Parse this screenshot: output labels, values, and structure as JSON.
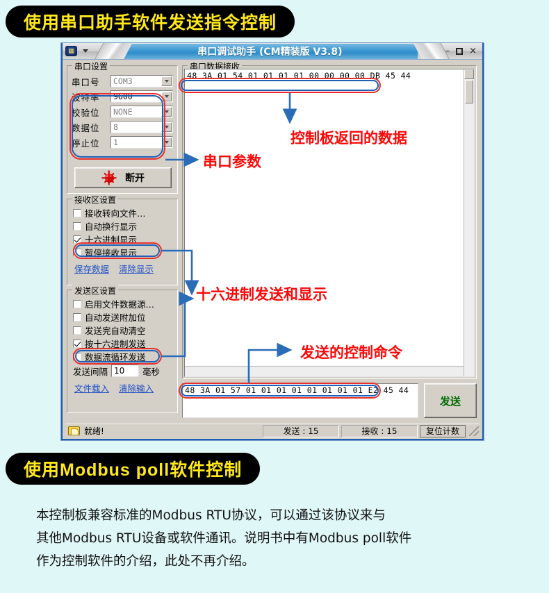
{
  "headings": {
    "top": "使用串口助手软件发送指令控制",
    "bottom": "使用Modbus poll软件控制"
  },
  "window": {
    "title": "串口调试助手 (CM精装版 V3.8)",
    "logo_icon": "app-logo-icon",
    "caret_icon": "chevron-down-icon",
    "minimize": "–",
    "maximize": "□",
    "close": "×"
  },
  "serial_group": {
    "title": "串口设置",
    "fields": [
      {
        "label": "串口号",
        "value": "COM3",
        "active": false
      },
      {
        "label": "波特率",
        "value": "9600",
        "active": true
      },
      {
        "label": "校验位",
        "value": "NONE",
        "active": false
      },
      {
        "label": "数据位",
        "value": "8",
        "active": false
      },
      {
        "label": "停止位",
        "value": "1",
        "active": false
      }
    ],
    "disconnect_label": "断开"
  },
  "recv_group": {
    "title": "接收区设置",
    "checks": [
      {
        "label": "接收转向文件…",
        "checked": false
      },
      {
        "label": "自动换行显示",
        "checked": false
      },
      {
        "label": "十六进制显示",
        "checked": true
      },
      {
        "label": "暂停接收显示",
        "checked": false
      }
    ],
    "links": [
      "保存数据",
      "清除显示"
    ]
  },
  "send_group": {
    "title": "发送区设置",
    "checks": [
      {
        "label": "启用文件数据源…",
        "checked": false
      },
      {
        "label": "自动发送附加位",
        "checked": false
      },
      {
        "label": "发送完自动清空",
        "checked": false
      },
      {
        "label": "按十六进制发送",
        "checked": true
      },
      {
        "label": "数据流循环发送",
        "checked": false
      }
    ],
    "interval_label": "发送间隔",
    "interval_value": "10",
    "interval_unit": "毫秒",
    "links": [
      "文件载入",
      "清除输入"
    ]
  },
  "rx_group": {
    "title": "串口数据接收",
    "data": "48 3A 01 54 01 01 01 01 00 00 00 00 DB 45 44"
  },
  "tx_area": {
    "data": "48 3A 01 57 01 01 01 01 01 01 01 01 E2 45 44",
    "send_button": "发送"
  },
  "statusbar": {
    "ready_icon": "hand-pointer-icon",
    "ready_text": "就绪!",
    "sent": "发送 : 15",
    "received": "接收 : 15",
    "reset_button": "复位计数"
  },
  "annotations": [
    {
      "id": "ann-serial-params",
      "text": "串口参数"
    },
    {
      "id": "ann-board-return",
      "text": "控制板返回的数据"
    },
    {
      "id": "ann-hex-send-show",
      "text": "十六进制发送和显示"
    },
    {
      "id": "ann-control-cmd",
      "text": "发送的控制命令"
    }
  ],
  "paragraph": [
    "本控制板兼容标准的Modbus RTU协议，可以通过该协议来与",
    "其他Modbus RTU设备或软件通讯。说明书中有Modbus poll软件",
    "作为控制软件的介绍，此处不再介绍。"
  ],
  "colors": {
    "page_background": "#e0f7f7",
    "heading_pill_bg": "#000000",
    "heading_text": "#ffe81a",
    "annotation_red": "#fb0808",
    "highlight_red": "#e8302a",
    "highlight_blue": "#1f5fb8",
    "titlebar_blue": "#3f9cd4",
    "link_blue": "#1f4fc4"
  }
}
